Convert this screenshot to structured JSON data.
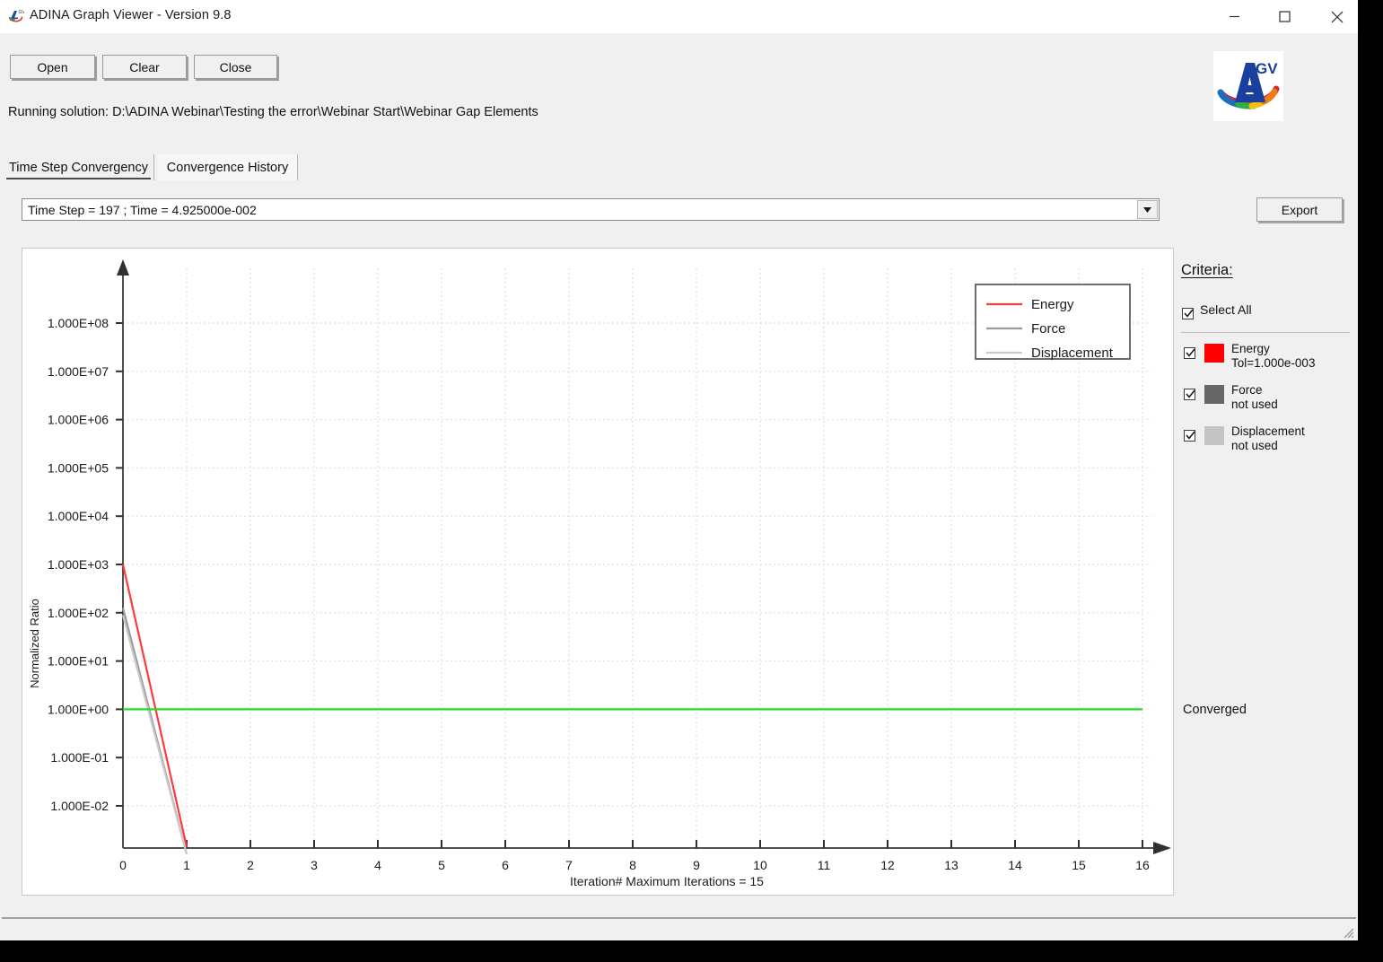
{
  "window": {
    "title": "ADINA Graph Viewer - Version 9.8",
    "app_icon": "adina-app-icon",
    "minimize_label": "–",
    "maximize_label": "□",
    "close_label": "✕"
  },
  "toolbar": {
    "open_label": "Open",
    "clear_label": "Clear",
    "close_label": "Close"
  },
  "status": {
    "running_solution": "Running solution:  D:\\ADINA Webinar\\Testing the error\\Webinar Start\\Webinar Gap Elements"
  },
  "logo": {
    "letter": "A",
    "superscript": "GV"
  },
  "tabs": [
    {
      "label": "Time Step Convergency",
      "selected": true
    },
    {
      "label": "Convergence History",
      "selected": false
    }
  ],
  "timestep_select": {
    "value": "Time Step = 197 ; Time = 4.925000e-002",
    "arrow_icon": "chevron-down-icon"
  },
  "export": {
    "label": "Export"
  },
  "criteria": {
    "title": "Criteria:",
    "select_all_label": "Select All",
    "select_all_checked": true,
    "items": [
      {
        "name": "Energy",
        "detail": "Tol=1.000e-003",
        "color": "#fe0000",
        "checked": true
      },
      {
        "name": "Force",
        "detail": "not used",
        "color": "#666666",
        "checked": true
      },
      {
        "name": "Displacement",
        "detail": "not used",
        "color": "#c4c4c4",
        "checked": true
      }
    ],
    "converged_label": "Converged"
  },
  "chart_data": {
    "type": "line",
    "title": "",
    "xlabel": "Iteration#   Maximum Iterations = 15",
    "ylabel": "Normalized Ratio",
    "xtick_labels": [
      "0",
      "1",
      "2",
      "3",
      "4",
      "5",
      "6",
      "7",
      "8",
      "9",
      "10",
      "11",
      "12",
      "13",
      "14",
      "15",
      "16"
    ],
    "xlim": [
      0,
      16
    ],
    "ytick_labels": [
      "1.000E+08",
      "1.000E+07",
      "1.000E+06",
      "1.000E+05",
      "1.000E+04",
      "1.000E+03",
      "1.000E+02",
      "1.000E+01",
      "1.000E+00",
      "1.000E-01",
      "1.000E-02"
    ],
    "ylim_log10": [
      -3,
      8
    ],
    "yscale": "log",
    "grid": true,
    "legend_position": "top-right",
    "threshold_line": {
      "value": 1.0,
      "color": "#22dd22",
      "label": ""
    },
    "series": [
      {
        "name": "Energy",
        "color": "#fe3b3b",
        "x": [
          0,
          1
        ],
        "y_log10": [
          3.0,
          -2.85
        ]
      },
      {
        "name": "Force",
        "color": "#9a9a9a",
        "x": [
          0,
          1
        ],
        "y_log10": [
          2.1,
          -3.0
        ]
      },
      {
        "name": "Displacement",
        "color": "#c9c9c9",
        "x": [
          0,
          1
        ],
        "y_log10": [
          1.95,
          -3.0
        ]
      }
    ],
    "legend_entries": [
      "Energy",
      "Force",
      "Displacement"
    ]
  }
}
